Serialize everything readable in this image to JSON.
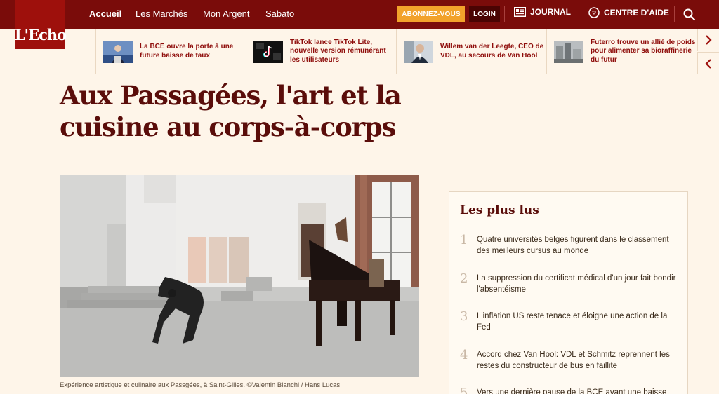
{
  "brand": {
    "logo_text": "L'Echo"
  },
  "nav": {
    "items": [
      {
        "label": "Accueil",
        "active": true
      },
      {
        "label": "Les Marchés",
        "active": false
      },
      {
        "label": "Mon Argent",
        "active": false
      },
      {
        "label": "Sabato",
        "active": false
      }
    ],
    "subscribe_label": "ABONNEZ-VOUS",
    "login_label": "LOGIN",
    "journal_label": "JOURNAL",
    "help_label": "CENTRE D'AIDE"
  },
  "ticker": [
    {
      "title": "La BCE ouvre la porte à une future baisse de taux",
      "thumb_icon": "person-at-podium-photo"
    },
    {
      "title": "TikTok lance TikTok Lite, nouvelle version rémunérant les utilisateurs",
      "thumb_icon": "tiktok-logo-photo"
    },
    {
      "title": "Willem van der Leegte, CEO de VDL, au secours de Van Hool",
      "thumb_icon": "man-in-suit-photo"
    },
    {
      "title": "Futerro trouve un allié de poids pour alimenter sa bioraffinerie du futur",
      "thumb_icon": "factory-photo"
    }
  ],
  "article": {
    "headline": "Aux Passagées, l'art et la cuisine au corps-à-corps",
    "caption": "Expérience artistique et culinaire aux Passgées, à Saint-Gilles. ©Valentin Bianchi / Hans Lucas"
  },
  "most_read": {
    "title": "Les plus lus",
    "items": [
      {
        "num": "1",
        "text": "Quatre universités belges figurent dans le classement des meilleurs cursus au monde"
      },
      {
        "num": "2",
        "text": "La suppression du certificat médical d'un jour fait bondir l'absentéisme"
      },
      {
        "num": "3",
        "text": "L'inflation US reste tenace et éloigne une action de la Fed"
      },
      {
        "num": "4",
        "text": "Accord chez Van Hool: VDL et Schmitz reprennent les restes du constructeur de bus en faillite"
      },
      {
        "num": "5",
        "text": "Vers une dernière pause de la BCE avant une baisse"
      }
    ]
  },
  "colors": {
    "topbar": "#7a0c0a",
    "logo_bg": "#9e100c",
    "subscribe": "#f2a22b",
    "headline": "#5a0d0a",
    "page_bg": "#fef5e9"
  }
}
